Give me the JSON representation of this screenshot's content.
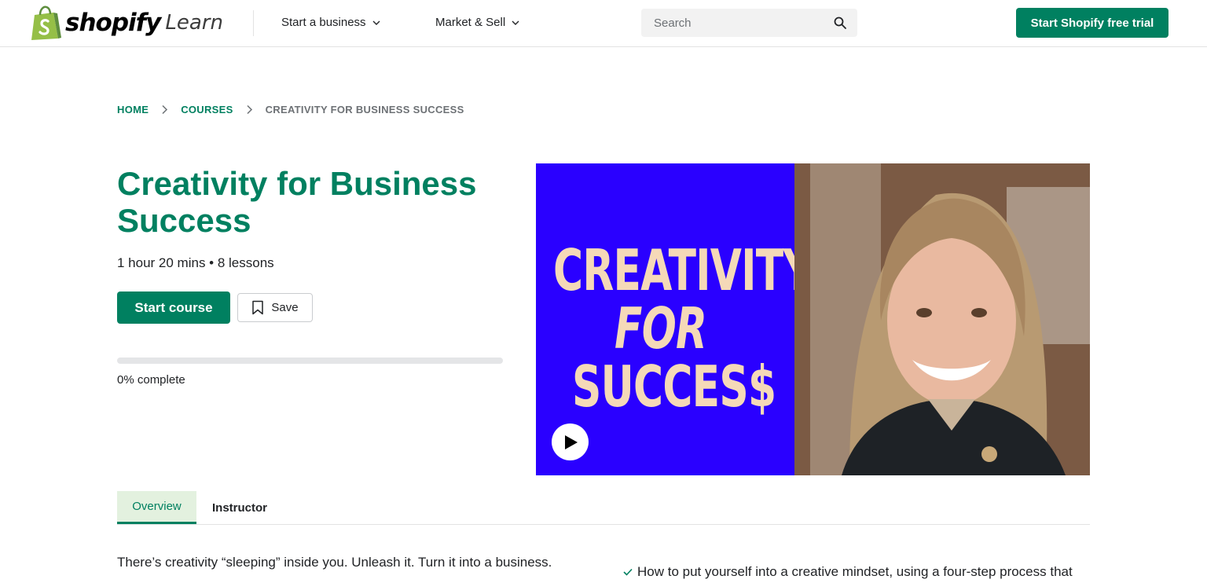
{
  "header": {
    "logo_word": "shopify",
    "logo_sub": "Learn",
    "nav": [
      {
        "label": "Start a business"
      },
      {
        "label": "Market & Sell"
      }
    ],
    "search_placeholder": "Search",
    "trial_button": "Start Shopify free trial"
  },
  "breadcrumb": {
    "items": [
      "HOME",
      "COURSES"
    ],
    "current": "CREATIVITY FOR BUSINESS SUCCESS"
  },
  "course": {
    "title": "Creativity for Business Success",
    "meta": "1 hour 20 mins • 8 lessons",
    "start_button": "Start course",
    "save_button": "Save",
    "progress_percent": 0,
    "progress_label": "0% complete"
  },
  "video": {
    "line1": "CREATIVITY",
    "line2": "FOR",
    "line3": "SUCCES$"
  },
  "tabs": [
    {
      "label": "Overview",
      "active": true
    },
    {
      "label": "Instructor",
      "active": false
    }
  ],
  "overview": {
    "intro": "There’s creativity “sleeping” inside you. Unleash it. Turn it into a business.",
    "bullet_1": "How to put yourself into a creative mindset, using a four-step process that"
  },
  "colors": {
    "brand_green": "#008060",
    "video_blue": "#2a00ff",
    "tab_active_bg": "#e3f1df"
  },
  "icons": [
    "shopify-bag-icon",
    "chevron-down-icon",
    "search-icon",
    "chevron-right-icon",
    "bookmark-icon",
    "play-icon",
    "check-icon"
  ]
}
